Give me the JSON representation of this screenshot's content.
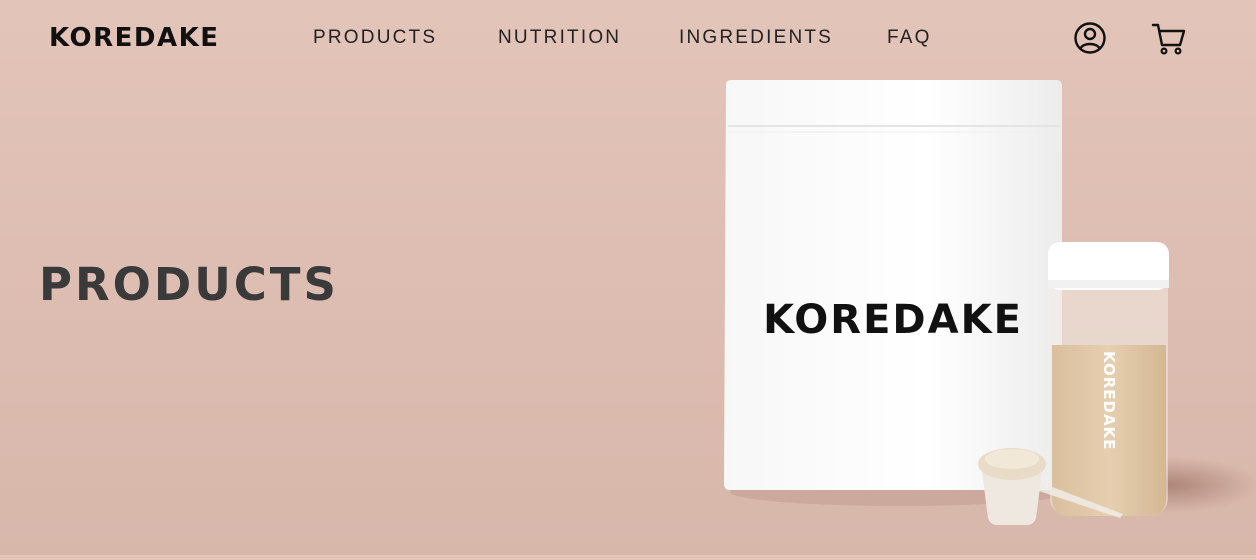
{
  "brand": {
    "name": "KOREDAKE"
  },
  "nav": {
    "items": [
      {
        "label": "PRODUCTS"
      },
      {
        "label": "NUTRITION"
      },
      {
        "label": "INGREDIENTS"
      },
      {
        "label": "FAQ"
      }
    ]
  },
  "header_icons": [
    "account-icon",
    "cart-icon"
  ],
  "hero": {
    "title": "PRODUCTS",
    "pouch_label": "KOREDAKE",
    "bottle_label": "KOREDAKE"
  },
  "colors": {
    "background": "#e0c1b6",
    "text": "#111111",
    "title": "#3a3a3a"
  }
}
